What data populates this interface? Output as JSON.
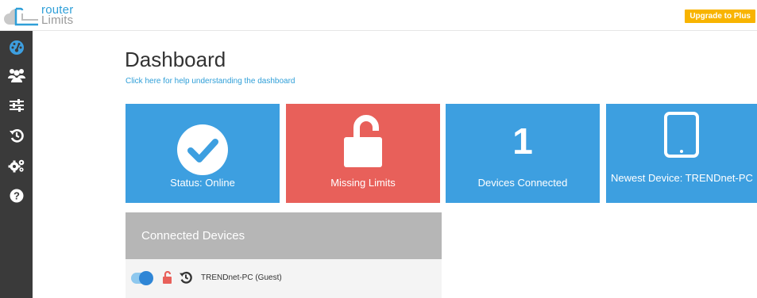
{
  "header": {
    "logo_line1": "router",
    "logo_line2": "Limits",
    "upgrade_label": "Upgrade to Plus"
  },
  "sidebar": {
    "items": [
      {
        "icon": "speedometer-icon"
      },
      {
        "icon": "users-icon"
      },
      {
        "icon": "sliders-icon"
      },
      {
        "icon": "history-icon"
      },
      {
        "icon": "gears-icon"
      },
      {
        "icon": "help-icon"
      }
    ]
  },
  "main": {
    "title": "Dashboard",
    "help_link": "Click here for help understanding the dashboard",
    "tiles": [
      {
        "label": "Status: Online",
        "icon": "check-circle-icon",
        "color": "#3d9fe0"
      },
      {
        "label": "Missing Limits",
        "icon": "unlocked-icon",
        "color": "#e8605a"
      },
      {
        "label": "Devices Connected",
        "value": "1",
        "color": "#3d9fe0"
      },
      {
        "label": "Newest Device: TRENDnet-PC",
        "icon": "tablet-icon",
        "color": "#3d9fe0"
      }
    ],
    "connected_devices": {
      "title": "Connected Devices",
      "rows": [
        {
          "name": "TRENDnet-PC (Guest)",
          "enabled": true
        }
      ]
    }
  },
  "colors": {
    "accent": "#2f9fd8",
    "upgrade": "#f8b400",
    "sidebar": "#3a3a3a",
    "tile_blue": "#3d9fe0",
    "tile_red": "#e8605a"
  }
}
